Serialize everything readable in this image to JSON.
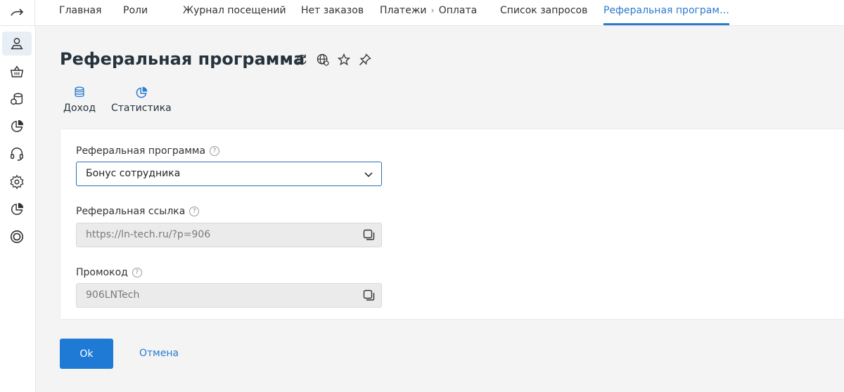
{
  "topbar": {
    "tabs": [
      {
        "label": "Главная"
      },
      {
        "label": "Роли"
      },
      {
        "label": "Журнал посещений"
      },
      {
        "label": "Нет заказов"
      },
      {
        "label": "Платежи",
        "child": "Оплата"
      },
      {
        "label": "Список запросов"
      },
      {
        "label": "Реферальная програм…",
        "active": true
      }
    ]
  },
  "page": {
    "title": "Реферальная программа"
  },
  "subnav": {
    "income": "Доход",
    "stats": "Статистика"
  },
  "form": {
    "program": {
      "label": "Реферальная программа",
      "value": "Бонус сотрудника"
    },
    "link": {
      "label": "Реферальная ссылка",
      "value": "https://ln-tech.ru/?p=906"
    },
    "promo": {
      "label": "Промокод",
      "value": "906LNTech"
    },
    "help_glyph": "?"
  },
  "actions": {
    "ok": "Ok",
    "cancel": "Отмена"
  },
  "colors": {
    "accent": "#1f7ad6",
    "link": "#2a7bcf"
  }
}
